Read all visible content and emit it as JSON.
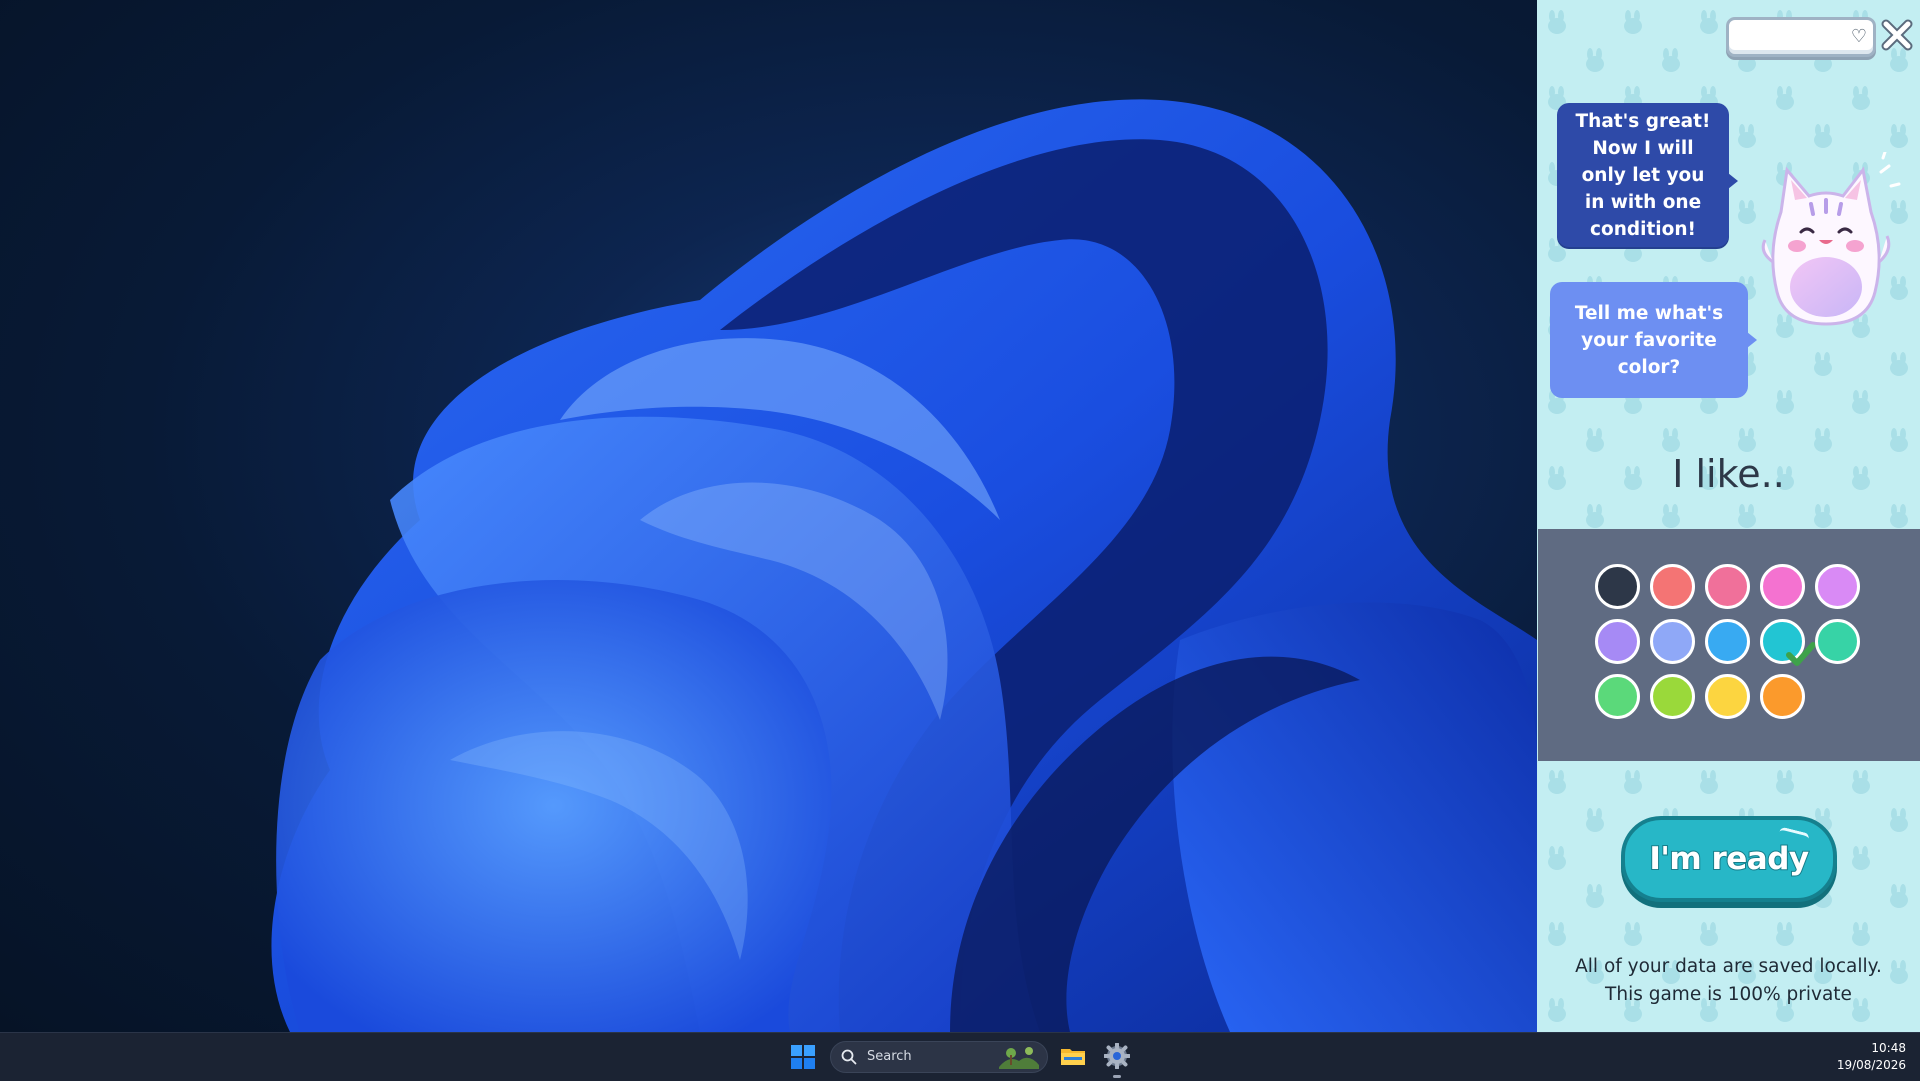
{
  "panel": {
    "bubble_1": "That's great! Now I will only let you in with one condition!",
    "bubble_2": "Tell me what's your favorite color?",
    "prompt": "I like..",
    "ready_button": "I'm ready",
    "privacy_line_1": "All of your data are saved locally.",
    "privacy_line_2": "This game is 100% private",
    "name_field_value": "",
    "close_icon": "close-x-icon",
    "heart_icon": "heart-icon",
    "mascot": "cat-mascot"
  },
  "palette": {
    "selected_index": 8,
    "colors": [
      "#2d3748",
      "#f47474",
      "#f0709a",
      "#f472d0",
      "#d98af5",
      "#a68af5",
      "#8fa8f7",
      "#38aaf2",
      "#22c5d3",
      "#37d3a6",
      "#5bd97a",
      "#9ad93a",
      "#fcd540",
      "#fb9a2c"
    ]
  },
  "taskbar": {
    "search_placeholder": "Search",
    "time": "10:48",
    "date": "19/08/2026",
    "icons": [
      "windows-start-icon",
      "search-icon",
      "file-explorer-icon",
      "settings-icon"
    ]
  },
  "colors": {
    "panel_background": "#c3eef2",
    "palette_background": "#5f6b82",
    "bubble_dark": "#2e4aa8",
    "bubble_light": "#6d8ff2",
    "ready_button": "#27b7c7",
    "taskbar": "#1b2333"
  }
}
